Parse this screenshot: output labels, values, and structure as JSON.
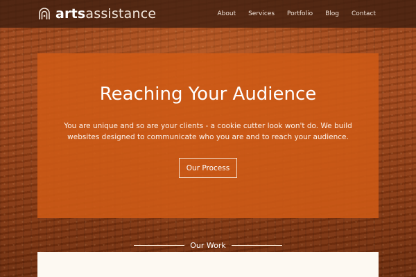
{
  "brand": {
    "bold": "arts",
    "light": "assistance"
  },
  "nav": {
    "items": [
      {
        "label": "About"
      },
      {
        "label": "Services"
      },
      {
        "label": "Portfolio"
      },
      {
        "label": "Blog"
      },
      {
        "label": "Contact"
      }
    ]
  },
  "hero": {
    "title": "Reaching Your Audience",
    "text": "You are unique and so are your clients - a cookie cutter look won't do. We build websites designed to communicate who you are and to reach your audience.",
    "button_label": "Our Process"
  },
  "section": {
    "title": "Our Work"
  },
  "colors": {
    "accent": "#ce5a16",
    "navbar": "#3c1e0f",
    "panel": "#fdf9f2"
  },
  "icons": {
    "logo": "arts-assistance-logo-icon"
  }
}
